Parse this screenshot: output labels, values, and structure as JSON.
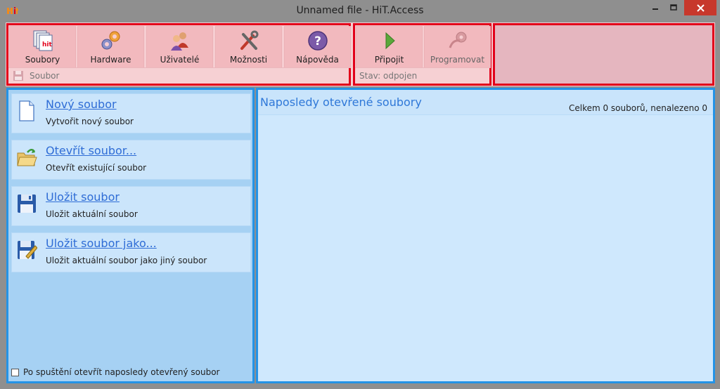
{
  "window": {
    "title": "Unnamed file - HiT.Access",
    "app_icon": "hit-logo-icon"
  },
  "ribbon": {
    "file_group": {
      "buttons": [
        {
          "label": "Soubory",
          "icon": "files-icon"
        },
        {
          "label": "Hardware",
          "icon": "hardware-gears-icon"
        },
        {
          "label": "Uživatelé",
          "icon": "users-icon"
        },
        {
          "label": "Možnosti",
          "icon": "tools-icon"
        },
        {
          "label": "Nápověda",
          "icon": "help-icon"
        }
      ],
      "footer": "Soubor"
    },
    "connection_group": {
      "buttons": [
        {
          "label": "Připojit",
          "icon": "play-icon"
        },
        {
          "label": "Programovat",
          "icon": "program-icon"
        }
      ],
      "footer": "Stav: odpojen"
    }
  },
  "actions": [
    {
      "title": "Nový soubor",
      "description": "Vytvořit nový soubor",
      "icon": "new-file-icon"
    },
    {
      "title": "Otevřít soubor...",
      "description": "Otevřít existující soubor",
      "icon": "open-folder-icon"
    },
    {
      "title": "Uložit soubor",
      "description": "Uložit aktuální soubor",
      "icon": "save-icon"
    },
    {
      "title": "Uložit soubor jako...",
      "description": "Uložit aktuální soubor jako jiný soubor",
      "icon": "save-as-icon"
    }
  ],
  "startup_option": {
    "label": "Po spuštění otevřít naposledy otevřený soubor",
    "checked": false
  },
  "recent": {
    "title": "Naposledy otevřené soubory",
    "count_text": "Celkem 0 souborů, nenalezeno 0"
  },
  "colors": {
    "highlight_red": "#e2001a",
    "highlight_blue": "#2493e6",
    "link": "#2f6dd6"
  }
}
